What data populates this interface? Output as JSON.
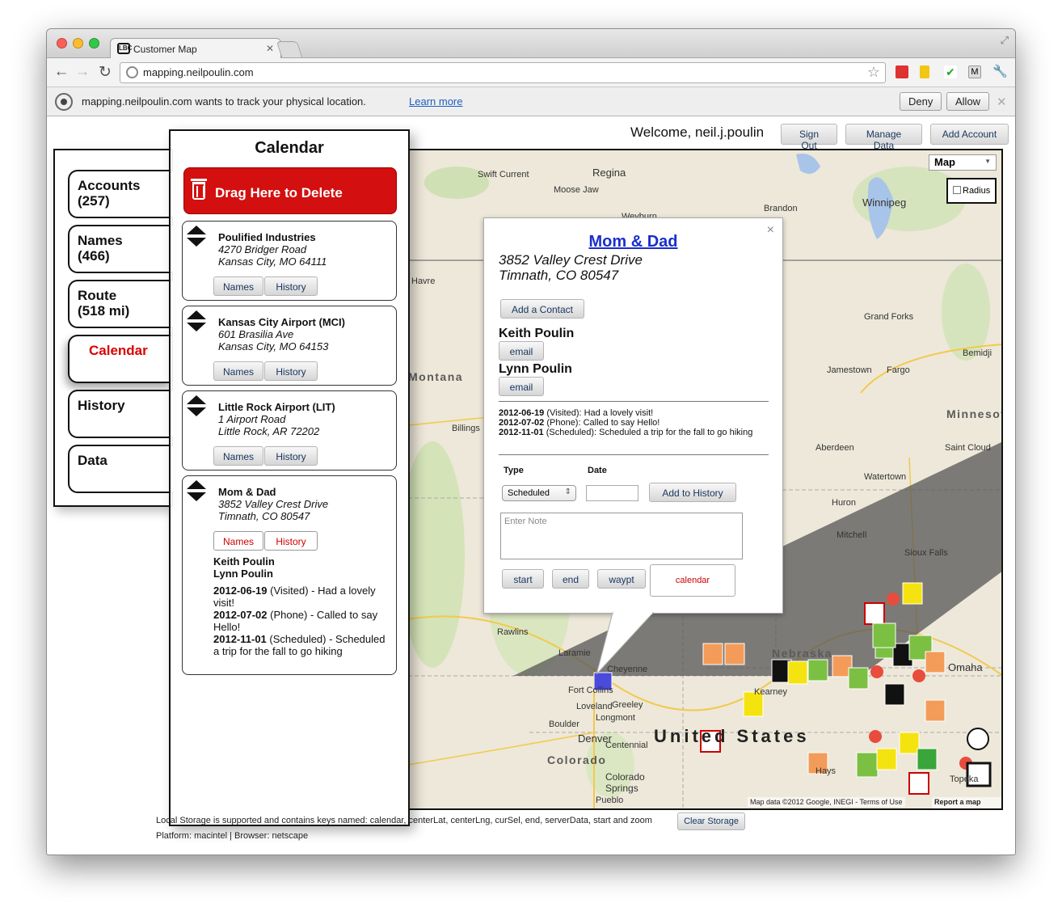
{
  "browser": {
    "tab_title": "Customer Map",
    "favicon_text": "LBC",
    "url": "mapping.neilpoulin.com",
    "infobar_message": "mapping.neilpoulin.com wants to track your physical location.",
    "infobar_link": "Learn more",
    "deny_label": "Deny",
    "allow_label": "Allow"
  },
  "header": {
    "welcome": "Welcome, neil.j.poulin",
    "sign_out": "Sign Out",
    "manage_data": "Manage Data",
    "add_account": "Add Account"
  },
  "sidebar": {
    "tabs": [
      {
        "line1": "Accounts",
        "line2": "(257)"
      },
      {
        "line1": "Names",
        "line2": "(466)"
      },
      {
        "line1": "Route",
        "line2": "(518 mi)"
      },
      {
        "line1": "Calendar",
        "line2": ""
      },
      {
        "line1": "History",
        "line2": ""
      },
      {
        "line1": "Data",
        "line2": ""
      }
    ],
    "active_tab": "Calendar"
  },
  "calendar": {
    "title": "Calendar",
    "delete_zone": "Drag Here to Delete",
    "names_label": "Names",
    "history_label": "History",
    "items": [
      {
        "name": "Poulified Industries",
        "street": "4270 Bridger Road",
        "city": "Kansas City, MO 64111"
      },
      {
        "name": "Kansas City Airport (MCI)",
        "street": "601 Brasilia Ave",
        "city": "Kansas City, MO 64153"
      },
      {
        "name": "Little Rock Airport (LIT)",
        "street": "1 Airport Road",
        "city": "Little Rock, AR 72202"
      },
      {
        "name": "Mom & Dad",
        "street": "3852 Valley Crest Drive",
        "city": "Timnath, CO 80547"
      }
    ],
    "expanded": {
      "contacts": [
        "Keith Poulin",
        "Lynn Poulin"
      ],
      "history": [
        {
          "date": "2012-06-19",
          "text": " (Visited) - Had a lovely visit!"
        },
        {
          "date": "2012-07-02",
          "text": " (Phone) - Called to say Hello!"
        },
        {
          "date": "2012-11-01",
          "text": " (Scheduled) - Scheduled a trip for the fall to go hiking"
        }
      ]
    }
  },
  "infowindow": {
    "title": "Mom & Dad",
    "street": "3852 Valley Crest Drive",
    "city": "Timnath, CO 80547",
    "add_contact": "Add a Contact",
    "contacts": [
      "Keith Poulin",
      "Lynn Poulin"
    ],
    "email_label": "email",
    "history": [
      {
        "date": "2012-06-19",
        "text": " (Visited): Had a lovely visit!"
      },
      {
        "date": "2012-07-02",
        "text": " (Phone): Called to say Hello!"
      },
      {
        "date": "2012-11-01",
        "text": " (Scheduled): Scheduled a trip for the fall to go hiking"
      }
    ],
    "type_label": "Type",
    "date_label": "Date",
    "type_value": "Scheduled",
    "date_value": "",
    "add_history": "Add to History",
    "note_placeholder": "Enter Note",
    "start": "start",
    "end": "end",
    "waypt": "waypt",
    "calendar": "calendar",
    "close": "×"
  },
  "map": {
    "map_type": "Map",
    "radius_label": "Radius",
    "attribution": "Map data ©2012 Google, INEGI - Terms of Use",
    "report": "Report a map error",
    "country": "United States",
    "states": [
      "Montana",
      "Nebraska",
      "Colorado",
      "Minnesota"
    ],
    "cities": [
      "Regina",
      "Swift Current",
      "Moose Jaw",
      "Brandon",
      "Winnipeg",
      "Weyburn",
      "Havre",
      "Grand Forks",
      "Bemidji",
      "Jamestown",
      "Fargo",
      "Billings",
      "Aberdeen",
      "Saint Cloud",
      "Watertown",
      "Huron",
      "Mitchell",
      "Sioux Falls",
      "Cheyenne",
      "Fort Collins",
      "Greeley",
      "Loveland",
      "Longmont",
      "Boulder",
      "Denver",
      "Centennial",
      "Colorado Springs",
      "Pueblo",
      "Laramie",
      "Rawlins",
      "Kearney",
      "Omaha",
      "Topeka",
      "Hays",
      "Centennial"
    ]
  },
  "footer": {
    "storage_text": "Local Storage is supported and contains keys named: calendar, centerLat, centerLng, curSel, end, serverData, start and zoom",
    "platform_text": "Platform: macintel | Browser: netscape",
    "clear_storage": "Clear Storage"
  },
  "colors": {
    "accent_red": "#d30f0f",
    "link_blue": "#1a2ecc",
    "button_text": "#18355e"
  }
}
